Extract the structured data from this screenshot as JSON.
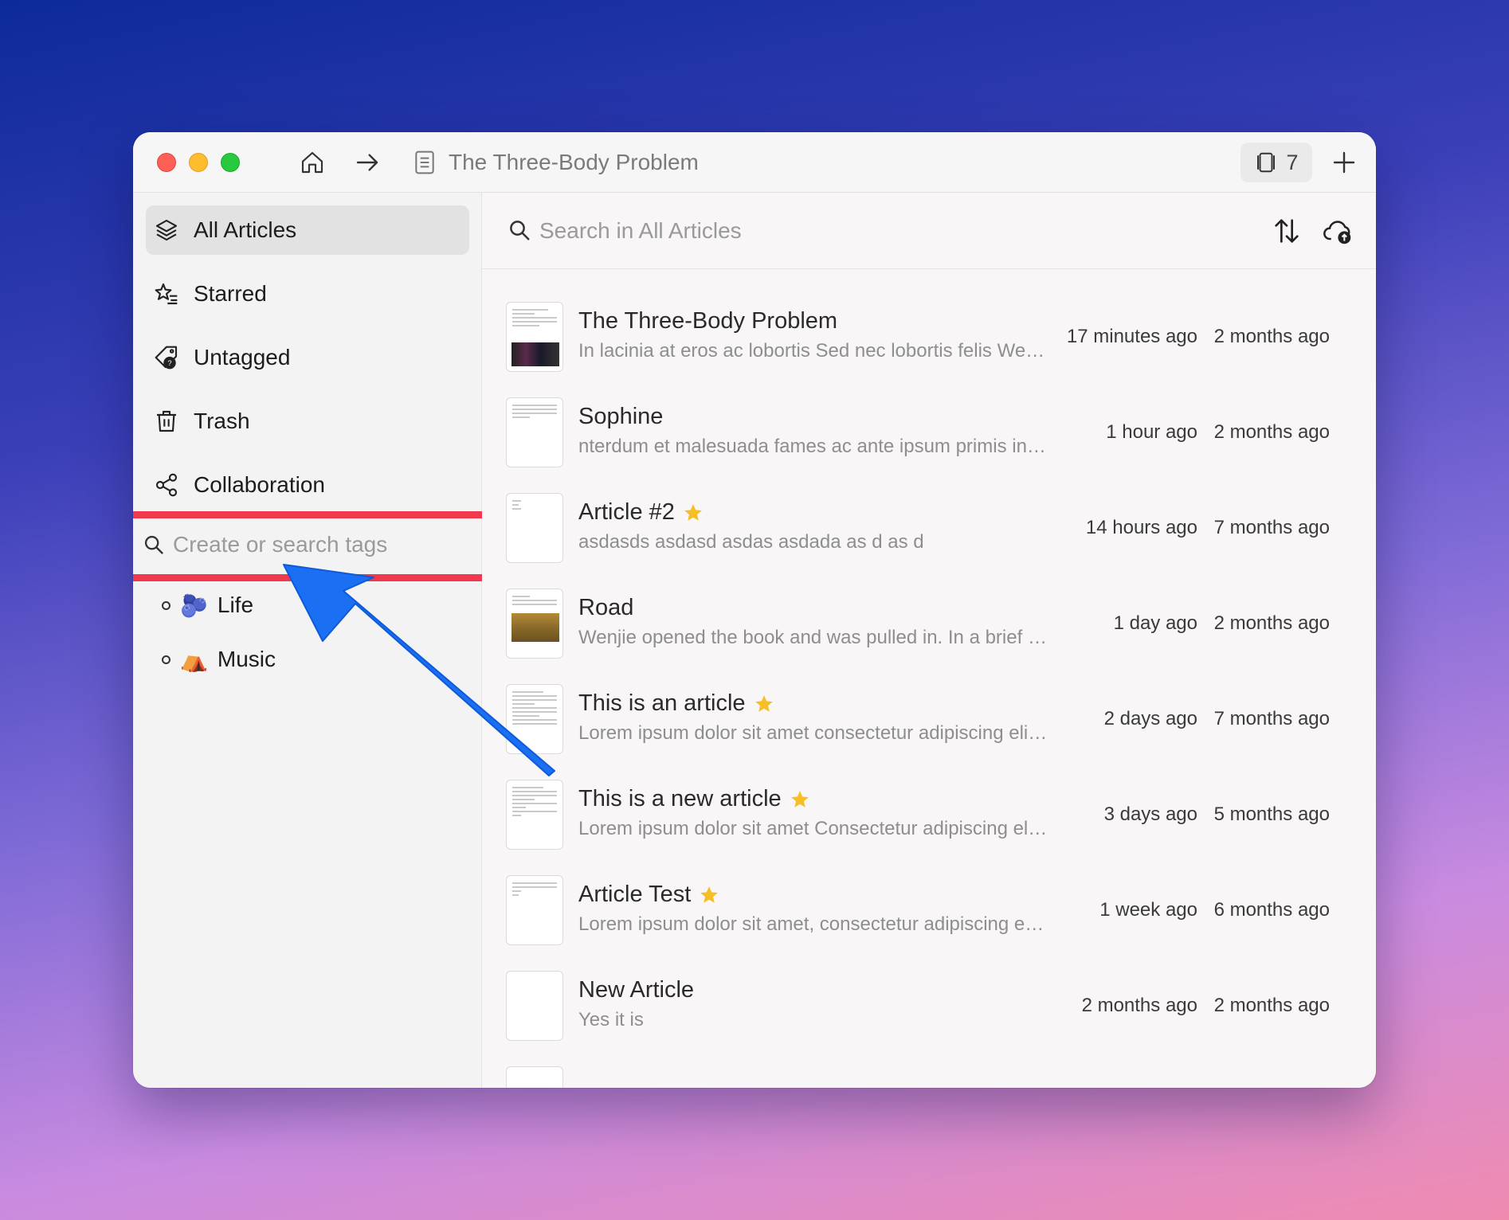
{
  "window": {
    "title": "The Three-Body Problem",
    "tab_count": "7"
  },
  "sidebar": {
    "items": [
      {
        "label": "All Articles",
        "icon": "layers-icon"
      },
      {
        "label": "Starred",
        "icon": "star-list-icon"
      },
      {
        "label": "Untagged",
        "icon": "tag-question-icon"
      },
      {
        "label": "Trash",
        "icon": "trash-icon"
      },
      {
        "label": "Collaboration",
        "icon": "share-icon"
      }
    ],
    "tag_search_placeholder": "Create or search tags",
    "tags": [
      {
        "label": "Life",
        "emoji": "🫐"
      },
      {
        "label": "Music",
        "emoji": "⛺"
      }
    ]
  },
  "main": {
    "search_placeholder": "Search in All Articles",
    "articles": [
      {
        "title": "The Three-Body Problem",
        "excerpt": "In lacinia at eros ac lobortis Sed nec lobortis felis We…",
        "modified": "17 minutes ago",
        "created": "2 months ago",
        "starred": false
      },
      {
        "title": "Sophine",
        "excerpt": "nterdum et malesuada fames ac ante ipsum primis in…",
        "modified": "1 hour ago",
        "created": "2 months ago",
        "starred": false
      },
      {
        "title": "Article #2",
        "excerpt": "asdasds asdasd asdas asdada as d as d",
        "modified": "14 hours ago",
        "created": "7 months ago",
        "starred": true
      },
      {
        "title": "Road",
        "excerpt": "Wenjie opened the book and was pulled in. In a brief …",
        "modified": "1 day ago",
        "created": "2 months ago",
        "starred": false
      },
      {
        "title": "This is an article",
        "excerpt": "Lorem ipsum dolor sit amet consectetur adipiscing eli…",
        "modified": "2 days ago",
        "created": "7 months ago",
        "starred": true
      },
      {
        "title": "This is a new article",
        "excerpt": "Lorem ipsum dolor sit amet Consectetur adipiscing el…",
        "modified": "3 days ago",
        "created": "5 months ago",
        "starred": true
      },
      {
        "title": "Article Test",
        "excerpt": "Lorem ipsum dolor sit amet, consectetur adipiscing e…",
        "modified": "1 week ago",
        "created": "6 months ago",
        "starred": true
      },
      {
        "title": "New Article",
        "excerpt": "Yes it is",
        "modified": "2 months ago",
        "created": "2 months ago",
        "starred": false
      }
    ]
  },
  "colors": {
    "highlight": "#f0394d",
    "arrow": "#1a6ff2",
    "star": "#f6bf26"
  }
}
